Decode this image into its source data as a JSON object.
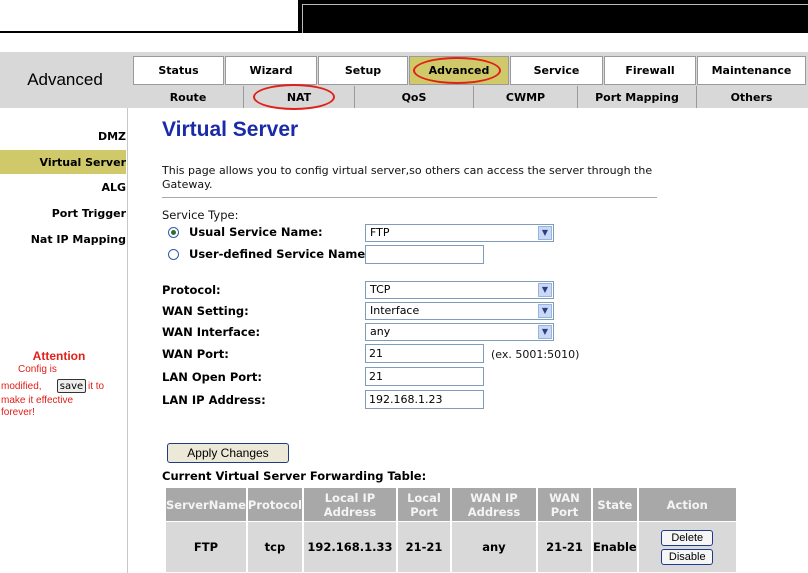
{
  "brand": "Advanced",
  "main_tabs": [
    "Status",
    "Wizard",
    "Setup",
    "Advanced",
    "Service",
    "Firewall",
    "Maintenance"
  ],
  "active_main_tab": "Advanced",
  "sub_tabs": [
    "Route",
    "NAT",
    "QoS",
    "CWMP",
    "Port Mapping",
    "Others"
  ],
  "active_sub_tab": "NAT",
  "sidebar": {
    "items": [
      "DMZ",
      "Virtual Server",
      "ALG",
      "Port Trigger",
      "Nat IP Mapping"
    ],
    "active": "Virtual Server",
    "attention": {
      "title": "Attention",
      "line1": "Config is",
      "line2_pre": "modified,",
      "save_label": "save",
      "line2_post": "it to",
      "line3": "make it effective",
      "line4": "forever!"
    }
  },
  "page": {
    "title": "Virtual Server",
    "description_line1": "This page allows you to config virtual server,so others can access the server through the",
    "description_line2": "Gateway."
  },
  "form": {
    "service_type_label": "Service Type:",
    "usual_service_label": "Usual Service Name:",
    "usual_service_value": "FTP",
    "user_defined_label": "User-defined Service Name:",
    "user_defined_value": "",
    "protocol_label": "Protocol:",
    "protocol_value": "TCP",
    "wan_setting_label": "WAN Setting:",
    "wan_setting_value": "Interface",
    "wan_interface_label": "WAN Interface:",
    "wan_interface_value": "any",
    "wan_port_label": "WAN Port:",
    "wan_port_value": "21",
    "wan_port_hint": "(ex. 5001:5010)",
    "lan_open_port_label": "LAN Open Port:",
    "lan_open_port_value": "21",
    "lan_ip_label": "LAN IP Address:",
    "lan_ip_value": "192.168.1.23",
    "apply_label": "Apply Changes"
  },
  "table": {
    "caption": "Current Virtual Server Forwarding Table:",
    "headers": [
      "ServerName",
      "Protocol",
      "Local IP Address",
      "Local Port",
      "WAN IP Address",
      "WAN Port",
      "State",
      "Action"
    ],
    "rows": [
      {
        "server": "FTP",
        "protocol": "tcp",
        "local_ip": "192.168.1.33",
        "local_port": "21-21",
        "wan_ip": "any",
        "wan_port": "21-21",
        "state": "Enable",
        "delete_label": "Delete",
        "disable_label": "Disable"
      }
    ]
  },
  "colors": {
    "accent": "#cfc96a",
    "highlight": "#e0201a",
    "title": "#1a2aa8"
  }
}
